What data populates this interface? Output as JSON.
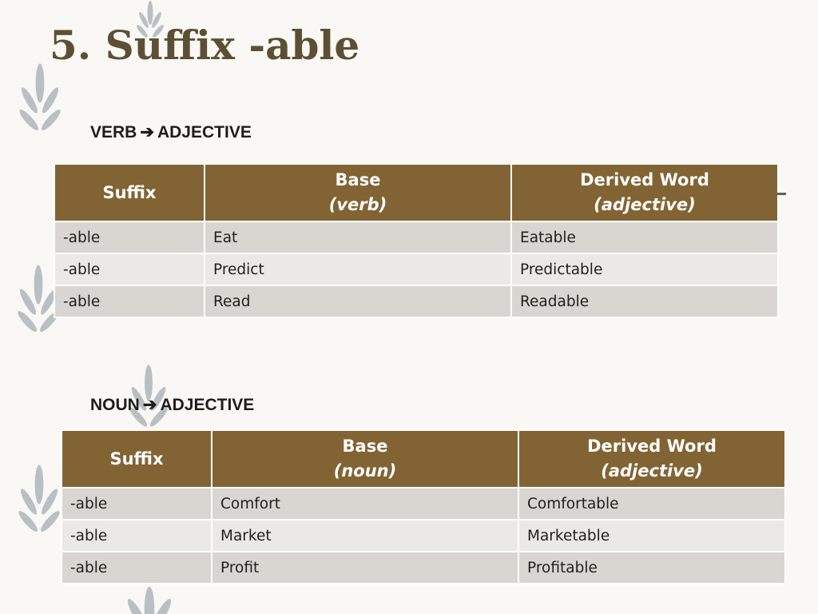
{
  "slide": {
    "title": "5.  Suffix -able",
    "colors": {
      "title": "#5c4f33",
      "header_bg": "#826434",
      "row_odd": "#d9d6d1",
      "row_even": "#ebe9e5",
      "leaf": "#b9c0c4",
      "background": "#f9f8f4"
    }
  },
  "verb_section": {
    "label_from": "VERB",
    "arrow": "➔",
    "label_to": "ADJECTIVE",
    "headers": {
      "suffix": "Suffix",
      "base": "Base",
      "base_sub": "(verb)",
      "derived": "Derived Word",
      "derived_sub": "(adjective)"
    },
    "rows": [
      {
        "suffix": "-able",
        "base": "Eat",
        "derived": "Eatable"
      },
      {
        "suffix": "-able",
        "base": "Predict",
        "derived": "Predictable"
      },
      {
        "suffix": "-able",
        "base": "Read",
        "derived": "Readable"
      }
    ]
  },
  "noun_section": {
    "label_from": "NOUN",
    "arrow": "➔",
    "label_to": "ADJECTIVE",
    "headers": {
      "suffix": "Suffix",
      "base": "Base",
      "base_sub": "(noun)",
      "derived": "Derived Word",
      "derived_sub": "(adjective)"
    },
    "rows": [
      {
        "suffix": "-able",
        "base": "Comfort",
        "derived": "Comfortable"
      },
      {
        "suffix": "-able",
        "base": "Market",
        "derived": "Marketable"
      },
      {
        "suffix": "-able",
        "base": "Profit",
        "derived": "Profitable"
      }
    ]
  },
  "decorations": {
    "icon": "leaf-sprig-icon"
  }
}
